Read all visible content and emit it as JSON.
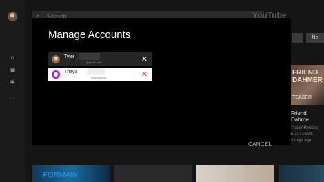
{
  "header": {
    "search_placeholder": "Search",
    "logo": "YouTube"
  },
  "chips": [
    "",
    "Ne"
  ],
  "side_thumb": {
    "line1": "FRIEND",
    "line2": "DAHMER",
    "caption": "TEASER"
  },
  "side_video": {
    "title": "Friend Dahme",
    "meta1": "Trailer Release",
    "meta2": "5,717 views",
    "meta3": "2 days ago"
  },
  "bottom_text": "FORMAW",
  "dialog": {
    "title": "Manage Accounts",
    "accounts": [
      {
        "name": "Tyler",
        "email": "@gmail.com"
      },
      {
        "name": "Thaya",
        "email": "@gmail.com"
      }
    ],
    "cancel_label": "CANCEL"
  },
  "colors": {
    "dialog_bg": "#000000",
    "selected_row": "#ffffff",
    "remove_red": "#e53935",
    "avatar_purple": "#9c27b0"
  },
  "icons": {
    "rail": [
      "home-icon",
      "subscriptions-icon",
      "settings-icon",
      "more-icon"
    ],
    "row_remove": "close-icon",
    "default_avatar": "person-icon"
  }
}
